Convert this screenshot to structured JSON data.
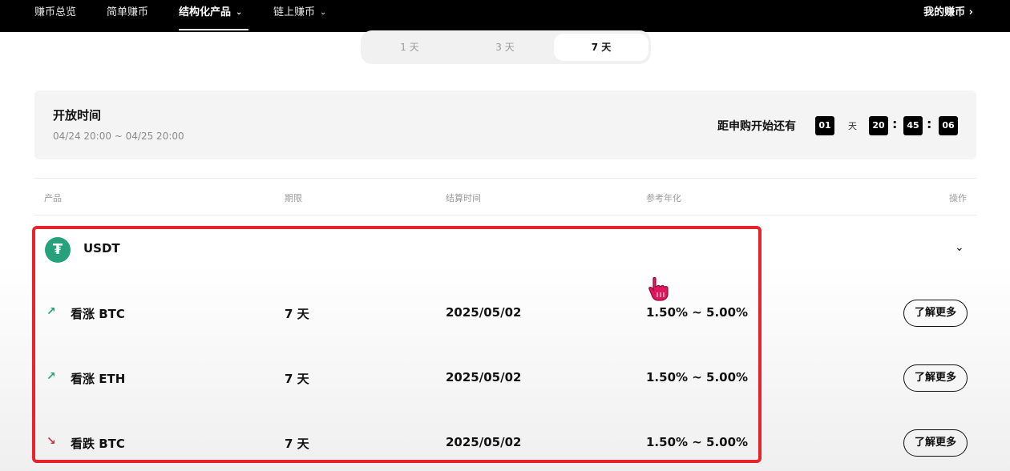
{
  "nav": {
    "items": [
      {
        "label": "赚币总览"
      },
      {
        "label": "简单赚币"
      },
      {
        "label": "结构化产品"
      },
      {
        "label": "链上赚币"
      }
    ],
    "my_earn": "我的赚币 ›"
  },
  "durations": {
    "tabs": [
      {
        "label": "1 天"
      },
      {
        "label": "3 天"
      },
      {
        "label": "7 天"
      }
    ],
    "selected": "7 天"
  },
  "open_time": {
    "title": "开放时间",
    "range": "04/24 20:00 ~ 04/25 20:00",
    "countdown_label": "距申购开始还有",
    "days": "01",
    "day_unit": "天",
    "hours": "20",
    "minutes": "45",
    "seconds": "06"
  },
  "table": {
    "headers": {
      "product": "产品",
      "term": "期限",
      "settlement": "结算时间",
      "apy": "参考年化",
      "action": "操作"
    },
    "group": {
      "coin": "USDT",
      "icon_glyph": "₮",
      "icon_color": "#26a17b"
    },
    "rows": [
      {
        "direction": "up",
        "arrow": "↗",
        "name": "看涨 BTC",
        "term": "7 天",
        "settlement": "2025/05/02",
        "apy": "1.50% ~ 5.00%",
        "action": "了解更多"
      },
      {
        "direction": "up",
        "arrow": "↗",
        "name": "看涨 ETH",
        "term": "7 天",
        "settlement": "2025/05/02",
        "apy": "1.50% ~ 5.00%",
        "action": "了解更多"
      },
      {
        "direction": "down",
        "arrow": "↘",
        "name": "看跌 BTC",
        "term": "7 天",
        "settlement": "2025/05/02",
        "apy": "1.50% ~ 5.00%",
        "action": "了解更多"
      }
    ]
  },
  "colors": {
    "highlight": "#e8232a",
    "up": "#1fa86b",
    "down": "#c2304f"
  }
}
